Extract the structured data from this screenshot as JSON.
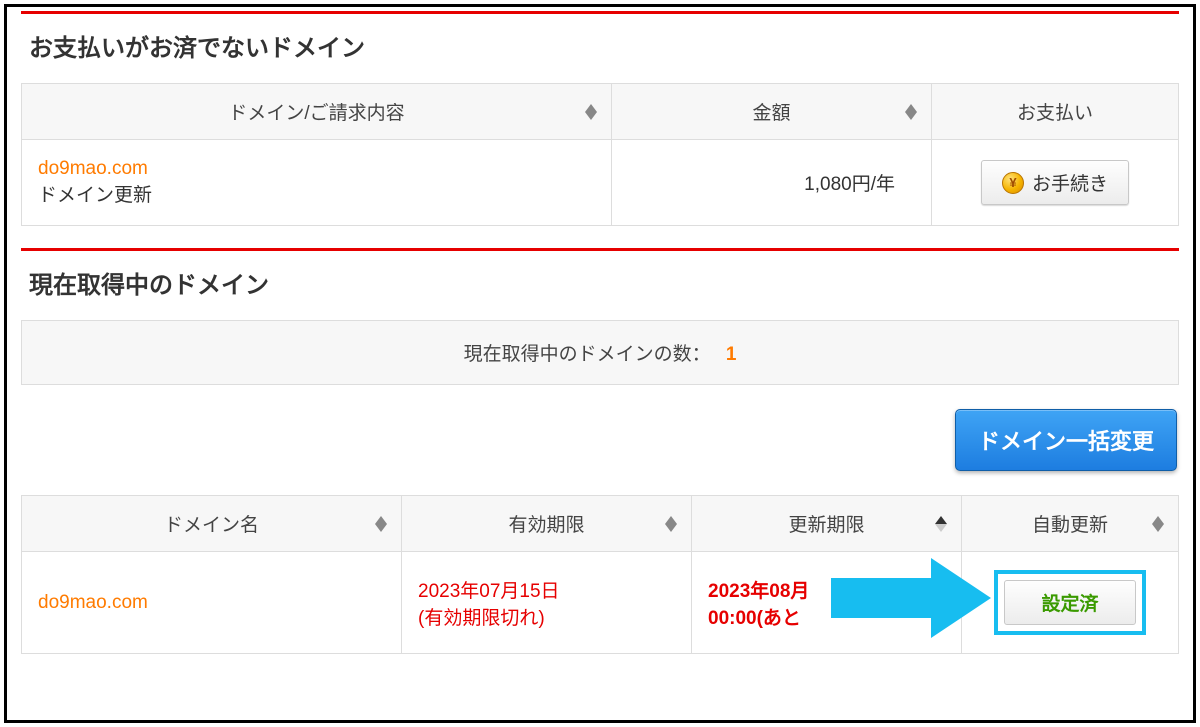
{
  "section1": {
    "title": "お支払いがお済でないドメイン",
    "headers": {
      "domain": "ドメイン/ご請求内容",
      "amount": "金額",
      "payment": "お支払い"
    },
    "row": {
      "domain": "do9mao.com",
      "desc": "ドメイン更新",
      "amount": "1,080円/年",
      "proc_label": "お手続き"
    }
  },
  "section2": {
    "title": "現在取得中のドメイン",
    "count_label": "現在取得中のドメインの数：",
    "count_value": "1",
    "bulk_button": "ドメイン一括変更",
    "headers": {
      "name": "ドメイン名",
      "valid": "有効期限",
      "renew": "更新期限",
      "auto": "自動更新"
    },
    "row": {
      "domain": "do9mao.com",
      "valid_date": "2023年07月15日",
      "valid_note": "(有効期限切れ)",
      "renew_date": "2023年08月",
      "renew_time": "00:00(あと",
      "auto_label": "設定済"
    }
  }
}
